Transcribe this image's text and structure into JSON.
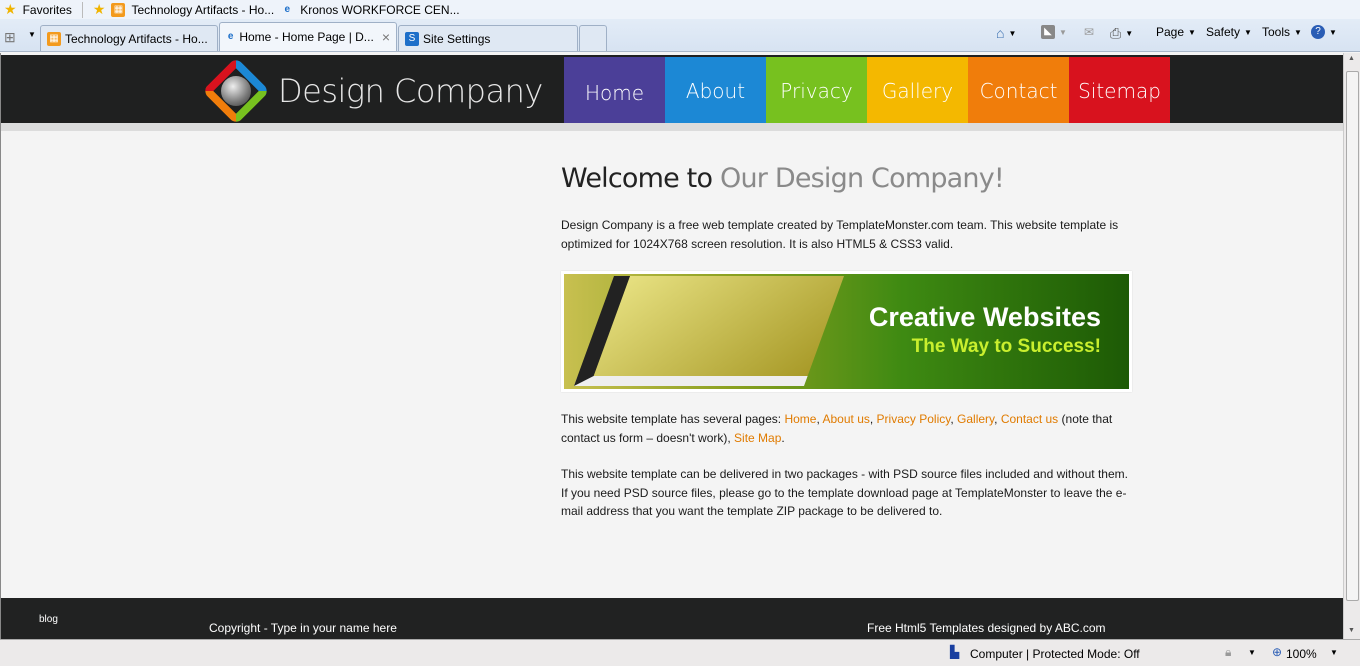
{
  "browser": {
    "favorites_label": "Favorites",
    "fav_links": [
      "Technology Artifacts - Ho...",
      "Kronos WORKFORCE CEN..."
    ],
    "tabs": [
      "Technology Artifacts - Ho...",
      "Home - Home Page | D...",
      "Site Settings"
    ],
    "close_glyph": "×",
    "commands": {
      "page": "Page",
      "safety": "Safety",
      "tools": "Tools"
    },
    "status": {
      "zone": "Computer | Protected Mode: Off",
      "zoom": "100%"
    }
  },
  "site": {
    "logo_text": "Design Company",
    "nav": [
      {
        "label": "Home",
        "color": "#4b3f98"
      },
      {
        "label": "About",
        "color": "#1c88d5"
      },
      {
        "label": "Privacy",
        "color": "#77c11f"
      },
      {
        "label": "Gallery",
        "color": "#f4b800"
      },
      {
        "label": "Contact",
        "color": "#f07d0b"
      },
      {
        "label": "Sitemap",
        "color": "#d8121e"
      }
    ],
    "heading_dark": "Welcome to",
    "heading_light": "Our Design Company!",
    "intro": "Design Company is a free web template created by TemplateMonster.com team. This website template is optimized for 1024X768 screen resolution. It is also HTML5 & CSS3 valid.",
    "banner": {
      "title": "Creative Websites",
      "subtitle": "The Way to Success!"
    },
    "pages_text": "This website template has several pages:",
    "links": [
      "Home",
      "About us",
      "Privacy Policy",
      "Gallery",
      "Contact us",
      "Site Map"
    ],
    "note": "(note that contact us form – doesn't work),",
    "packages": "This website template can be delivered in two packages - with PSD source files included and without them. If you need PSD source files, please go to the template download page at TemplateMonster to leave the e-mail address that you want the template ZIP package to be delivered to.",
    "footer": {
      "blog": "blog",
      "copyright": "Copyright - Type in your name here",
      "credit": "Free Html5 Templates designed by ABC.com"
    }
  }
}
